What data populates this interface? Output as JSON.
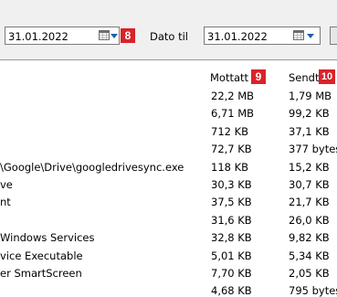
{
  "filter": {
    "from_date": "31.01.2022",
    "from_badge": "8",
    "to_label": "Dato til",
    "to_date": "31.01.2022"
  },
  "columns": {
    "received": "Mottatt",
    "received_badge": "9",
    "sent": "Sendt",
    "sent_badge": "10"
  },
  "rows": [
    {
      "name": "",
      "received": "22,2 MB",
      "sent": "1,79 MB"
    },
    {
      "name": "",
      "received": "6,71 MB",
      "sent": "99,2 KB"
    },
    {
      "name": "",
      "received": "712 KB",
      "sent": "37,1 KB"
    },
    {
      "name": "",
      "received": "72,7 KB",
      "sent": "377 bytes"
    },
    {
      "name": "\\Google\\Drive\\googledrivesync.exe",
      "received": "118 KB",
      "sent": "15,2 KB"
    },
    {
      "name": "ve",
      "received": "30,3 KB",
      "sent": "30,7 KB"
    },
    {
      "name": "nt",
      "received": "37,5 KB",
      "sent": "21,7 KB"
    },
    {
      "name": "",
      "received": "31,6 KB",
      "sent": "26,0 KB"
    },
    {
      "name": " Windows Services",
      "received": "32,8 KB",
      "sent": "9,82 KB"
    },
    {
      "name": "vice Executable",
      "received": "5,01 KB",
      "sent": "5,34 KB"
    },
    {
      "name": "er SmartScreen",
      "received": "7,70 KB",
      "sent": "2,05 KB"
    },
    {
      "name": "",
      "received": "4,68 KB",
      "sent": "795 bytes"
    }
  ]
}
